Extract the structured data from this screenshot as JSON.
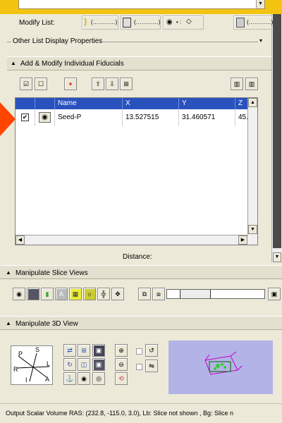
{
  "top_bar": {},
  "modify_list": {
    "label": "Modify List:",
    "btn1_text": "(…………)",
    "btn2_text": "(…………)",
    "btn3_text": "• :",
    "btn4_text": "(…………)"
  },
  "other_list": {
    "label": "Other List Display Properties"
  },
  "add_modify": {
    "label": "Add & Modify Individual Fiducials"
  },
  "table": {
    "columns": [
      "Name",
      "X",
      "Y",
      "Z"
    ],
    "rows": [
      {
        "name": "Seed-P",
        "x": "13.527515",
        "y": "31.460571",
        "z": "45."
      }
    ],
    "distance_label": "Distance:"
  },
  "manipulate_slice": {
    "label": "Manipulate Slice Views"
  },
  "manipulate_3d": {
    "label": "Manipulate 3D View"
  },
  "orientation": {
    "s": "S",
    "p": "P",
    "l": "L",
    "r": "R",
    "i": "I",
    "a": "A"
  },
  "status_bar": {
    "text": "Output Scalar Volume RAS: (232.8, -115.0, 3.0), Lb: Slice not shown , Bg: Slice n"
  },
  "colors": {
    "accent_yellow": "#f2c411",
    "header_blue": "#2a52be",
    "arrow_red": "#ff4500",
    "preview_bg": "#b3b3e8"
  }
}
